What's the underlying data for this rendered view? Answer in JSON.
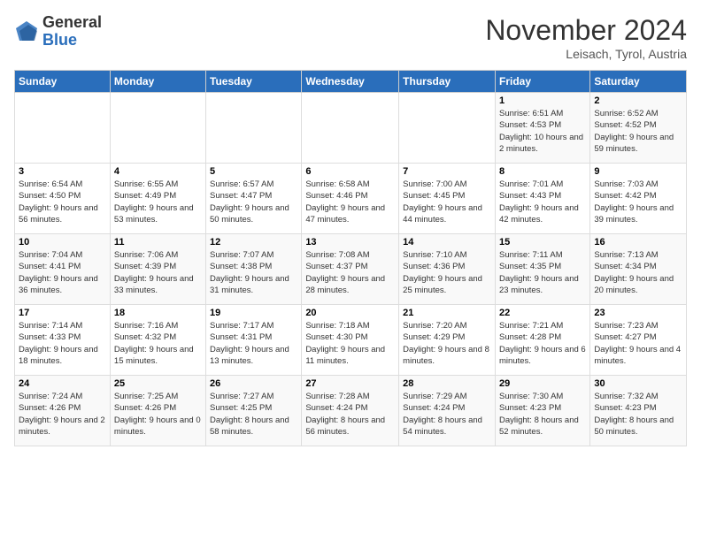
{
  "logo": {
    "general": "General",
    "blue": "Blue"
  },
  "header": {
    "title": "November 2024",
    "subtitle": "Leisach, Tyrol, Austria"
  },
  "weekdays": [
    "Sunday",
    "Monday",
    "Tuesday",
    "Wednesday",
    "Thursday",
    "Friday",
    "Saturday"
  ],
  "weeks": [
    [
      {
        "day": "",
        "info": ""
      },
      {
        "day": "",
        "info": ""
      },
      {
        "day": "",
        "info": ""
      },
      {
        "day": "",
        "info": ""
      },
      {
        "day": "",
        "info": ""
      },
      {
        "day": "1",
        "info": "Sunrise: 6:51 AM\nSunset: 4:53 PM\nDaylight: 10 hours and 2 minutes."
      },
      {
        "day": "2",
        "info": "Sunrise: 6:52 AM\nSunset: 4:52 PM\nDaylight: 9 hours and 59 minutes."
      }
    ],
    [
      {
        "day": "3",
        "info": "Sunrise: 6:54 AM\nSunset: 4:50 PM\nDaylight: 9 hours and 56 minutes."
      },
      {
        "day": "4",
        "info": "Sunrise: 6:55 AM\nSunset: 4:49 PM\nDaylight: 9 hours and 53 minutes."
      },
      {
        "day": "5",
        "info": "Sunrise: 6:57 AM\nSunset: 4:47 PM\nDaylight: 9 hours and 50 minutes."
      },
      {
        "day": "6",
        "info": "Sunrise: 6:58 AM\nSunset: 4:46 PM\nDaylight: 9 hours and 47 minutes."
      },
      {
        "day": "7",
        "info": "Sunrise: 7:00 AM\nSunset: 4:45 PM\nDaylight: 9 hours and 44 minutes."
      },
      {
        "day": "8",
        "info": "Sunrise: 7:01 AM\nSunset: 4:43 PM\nDaylight: 9 hours and 42 minutes."
      },
      {
        "day": "9",
        "info": "Sunrise: 7:03 AM\nSunset: 4:42 PM\nDaylight: 9 hours and 39 minutes."
      }
    ],
    [
      {
        "day": "10",
        "info": "Sunrise: 7:04 AM\nSunset: 4:41 PM\nDaylight: 9 hours and 36 minutes."
      },
      {
        "day": "11",
        "info": "Sunrise: 7:06 AM\nSunset: 4:39 PM\nDaylight: 9 hours and 33 minutes."
      },
      {
        "day": "12",
        "info": "Sunrise: 7:07 AM\nSunset: 4:38 PM\nDaylight: 9 hours and 31 minutes."
      },
      {
        "day": "13",
        "info": "Sunrise: 7:08 AM\nSunset: 4:37 PM\nDaylight: 9 hours and 28 minutes."
      },
      {
        "day": "14",
        "info": "Sunrise: 7:10 AM\nSunset: 4:36 PM\nDaylight: 9 hours and 25 minutes."
      },
      {
        "day": "15",
        "info": "Sunrise: 7:11 AM\nSunset: 4:35 PM\nDaylight: 9 hours and 23 minutes."
      },
      {
        "day": "16",
        "info": "Sunrise: 7:13 AM\nSunset: 4:34 PM\nDaylight: 9 hours and 20 minutes."
      }
    ],
    [
      {
        "day": "17",
        "info": "Sunrise: 7:14 AM\nSunset: 4:33 PM\nDaylight: 9 hours and 18 minutes."
      },
      {
        "day": "18",
        "info": "Sunrise: 7:16 AM\nSunset: 4:32 PM\nDaylight: 9 hours and 15 minutes."
      },
      {
        "day": "19",
        "info": "Sunrise: 7:17 AM\nSunset: 4:31 PM\nDaylight: 9 hours and 13 minutes."
      },
      {
        "day": "20",
        "info": "Sunrise: 7:18 AM\nSunset: 4:30 PM\nDaylight: 9 hours and 11 minutes."
      },
      {
        "day": "21",
        "info": "Sunrise: 7:20 AM\nSunset: 4:29 PM\nDaylight: 9 hours and 8 minutes."
      },
      {
        "day": "22",
        "info": "Sunrise: 7:21 AM\nSunset: 4:28 PM\nDaylight: 9 hours and 6 minutes."
      },
      {
        "day": "23",
        "info": "Sunrise: 7:23 AM\nSunset: 4:27 PM\nDaylight: 9 hours and 4 minutes."
      }
    ],
    [
      {
        "day": "24",
        "info": "Sunrise: 7:24 AM\nSunset: 4:26 PM\nDaylight: 9 hours and 2 minutes."
      },
      {
        "day": "25",
        "info": "Sunrise: 7:25 AM\nSunset: 4:26 PM\nDaylight: 9 hours and 0 minutes."
      },
      {
        "day": "26",
        "info": "Sunrise: 7:27 AM\nSunset: 4:25 PM\nDaylight: 8 hours and 58 minutes."
      },
      {
        "day": "27",
        "info": "Sunrise: 7:28 AM\nSunset: 4:24 PM\nDaylight: 8 hours and 56 minutes."
      },
      {
        "day": "28",
        "info": "Sunrise: 7:29 AM\nSunset: 4:24 PM\nDaylight: 8 hours and 54 minutes."
      },
      {
        "day": "29",
        "info": "Sunrise: 7:30 AM\nSunset: 4:23 PM\nDaylight: 8 hours and 52 minutes."
      },
      {
        "day": "30",
        "info": "Sunrise: 7:32 AM\nSunset: 4:23 PM\nDaylight: 8 hours and 50 minutes."
      }
    ]
  ]
}
